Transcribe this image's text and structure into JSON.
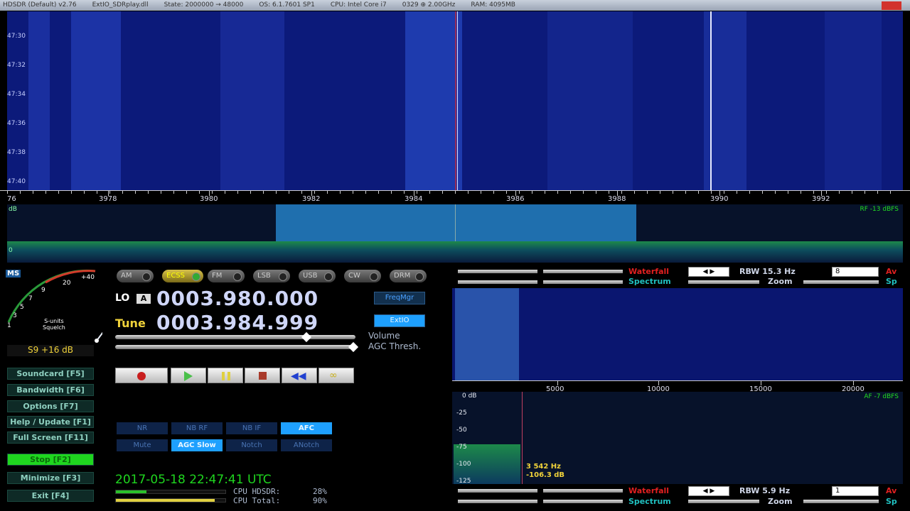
{
  "titlebar": {
    "segments": [
      "HDSDR (Default) v2.76",
      "ExtIO_SDRplay.dll",
      "State: 2000000 → 48000",
      "OS: 6.1.7601 SP1",
      "CPU: Intel Core i7",
      "0329 ⊕ 2.00GHz",
      "RAM: 4095MB"
    ]
  },
  "waterfall": {
    "time_labels": [
      "47:30",
      "47:32",
      "47:34",
      "47:36",
      "47:38",
      "47:40"
    ]
  },
  "freq_axis": {
    "labels": [
      "3978",
      "3980",
      "3982",
      "3984",
      "3986",
      "3988",
      "3990",
      "3992"
    ],
    "left_edge": "76"
  },
  "spectrum": {
    "db_label": "dB",
    "rf_label": "RF -13 dBFS",
    "zero_label": "0"
  },
  "smeter": {
    "ms_label": "MS",
    "scale_labels": [
      "20",
      "+40",
      "9",
      "7",
      "5",
      "3",
      "1"
    ],
    "caption": "S-units\nSquelch",
    "readout": "S9 +16 dB",
    "needle_level_fraction": 0.88
  },
  "modes": [
    {
      "label": "AM",
      "active": false
    },
    {
      "label": "ECSS",
      "active": true
    },
    {
      "label": "FM",
      "active": false
    },
    {
      "label": "LSB",
      "active": false
    },
    {
      "label": "USB",
      "active": false
    },
    {
      "label": "CW",
      "active": false
    },
    {
      "label": "DRM",
      "active": false
    }
  ],
  "lo": {
    "label": "LO",
    "badge": "A",
    "value": "0003.980.000"
  },
  "tune": {
    "label": "Tune",
    "value": "0003.984.999"
  },
  "buttons_blue": {
    "freqmgr": "FreqMgr",
    "extio": "ExtIO"
  },
  "sliders": {
    "volume": "Volume",
    "agc": "AGC Thresh."
  },
  "left_buttons": [
    {
      "key": "soundcard",
      "label": "Soundcard  [F5]"
    },
    {
      "key": "bandwidth",
      "label": "Bandwidth  [F6]"
    },
    {
      "key": "options",
      "label": "Options   [F7]"
    },
    {
      "key": "help",
      "label": "Help / Update  [F1]"
    },
    {
      "key": "fullscreen",
      "label": "Full Screen  [F11]"
    },
    {
      "key": "stop",
      "label": "Stop   [F2]"
    },
    {
      "key": "minimize",
      "label": "Minimize  [F3]"
    },
    {
      "key": "exit",
      "label": "Exit   [F4]"
    }
  ],
  "dsp_row1": [
    {
      "label": "NR",
      "active": false
    },
    {
      "label": "NB RF",
      "active": false
    },
    {
      "label": "NB IF",
      "active": false
    },
    {
      "label": "AFC",
      "active": true
    }
  ],
  "dsp_row2": [
    {
      "label": "Mute",
      "active": false
    },
    {
      "label": "AGC Slow",
      "active": true
    },
    {
      "label": "Notch",
      "active": false
    },
    {
      "label": "ANotch",
      "active": false
    }
  ],
  "datetime": "2017-05-18   22:47:41 UTC",
  "cpu": {
    "hdsdr_label": "CPU  HDSDR:",
    "hdsdr_value": "28%",
    "total_label": "CPU  Total:",
    "total_value": "90%"
  },
  "rf_controls": {
    "waterfall": "Waterfall",
    "spectrum": "Spectrum",
    "zoom": "Zoom",
    "rbw": "RBW 15.3 Hz",
    "combo": "8",
    "av": "Av",
    "sp": "Sp"
  },
  "af_controls": {
    "waterfall": "Waterfall",
    "spectrum": "Spectrum",
    "zoom": "Zoom",
    "rbw": "RBW 5.9 Hz",
    "combo": "1",
    "av": "Av",
    "sp": "Sp"
  },
  "audio_axis": {
    "labels": [
      "5000",
      "10000",
      "15000",
      "20000"
    ]
  },
  "audio_spec": {
    "db_labels": [
      "0 dB",
      "-25",
      "-50",
      "-75",
      "-100",
      "-125"
    ],
    "af_label": "AF -7 dBFS",
    "cursor_freq": "3 542 Hz",
    "cursor_db": "-106.3 dB"
  },
  "colors": {
    "accent_green": "#1fd61f",
    "accent_blue": "#1ea0ff",
    "waterfall_red": "#e02020"
  }
}
